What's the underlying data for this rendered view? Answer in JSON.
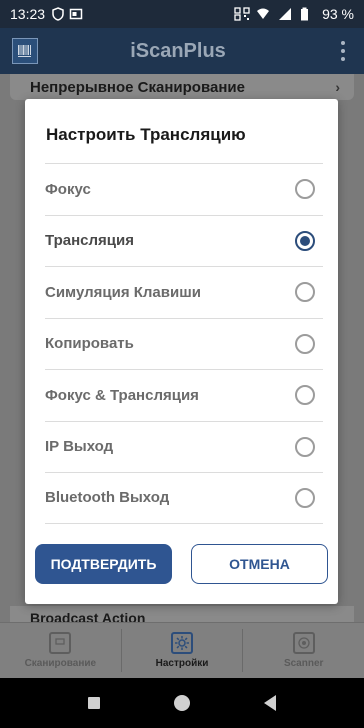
{
  "status_bar": {
    "time": "13:23",
    "battery": "93 %"
  },
  "app_bar": {
    "title": "iScanPlus"
  },
  "background": {
    "top_row_label": "Непрерывное Сканирование",
    "bottom_row_label": "Broadcast Action"
  },
  "bottom_nav": {
    "items": [
      {
        "label": "Сканирование",
        "icon": "scan-icon"
      },
      {
        "label": "Настройки",
        "icon": "settings-gear-icon"
      },
      {
        "label": "Scanner",
        "icon": "scanner-icon"
      }
    ],
    "active_index": 1
  },
  "dialog": {
    "title": "Настроить Трансляцию",
    "options": [
      {
        "label": "Фокус",
        "selected": false
      },
      {
        "label": "Трансляция",
        "selected": true
      },
      {
        "label": "Симуляция Клавиши",
        "selected": false
      },
      {
        "label": "Копировать",
        "selected": false
      },
      {
        "label": "Фокус & Трансляция",
        "selected": false
      },
      {
        "label": "IP Выход",
        "selected": false
      },
      {
        "label": "Bluetooth Выход",
        "selected": false
      }
    ],
    "confirm_label": "ПОДТВЕРДИТЬ",
    "cancel_label": "ОТМЕНА"
  },
  "colors": {
    "accent": "#2f5591",
    "app_bar": "#1f3550",
    "status_bar": "#1e2a3a"
  }
}
